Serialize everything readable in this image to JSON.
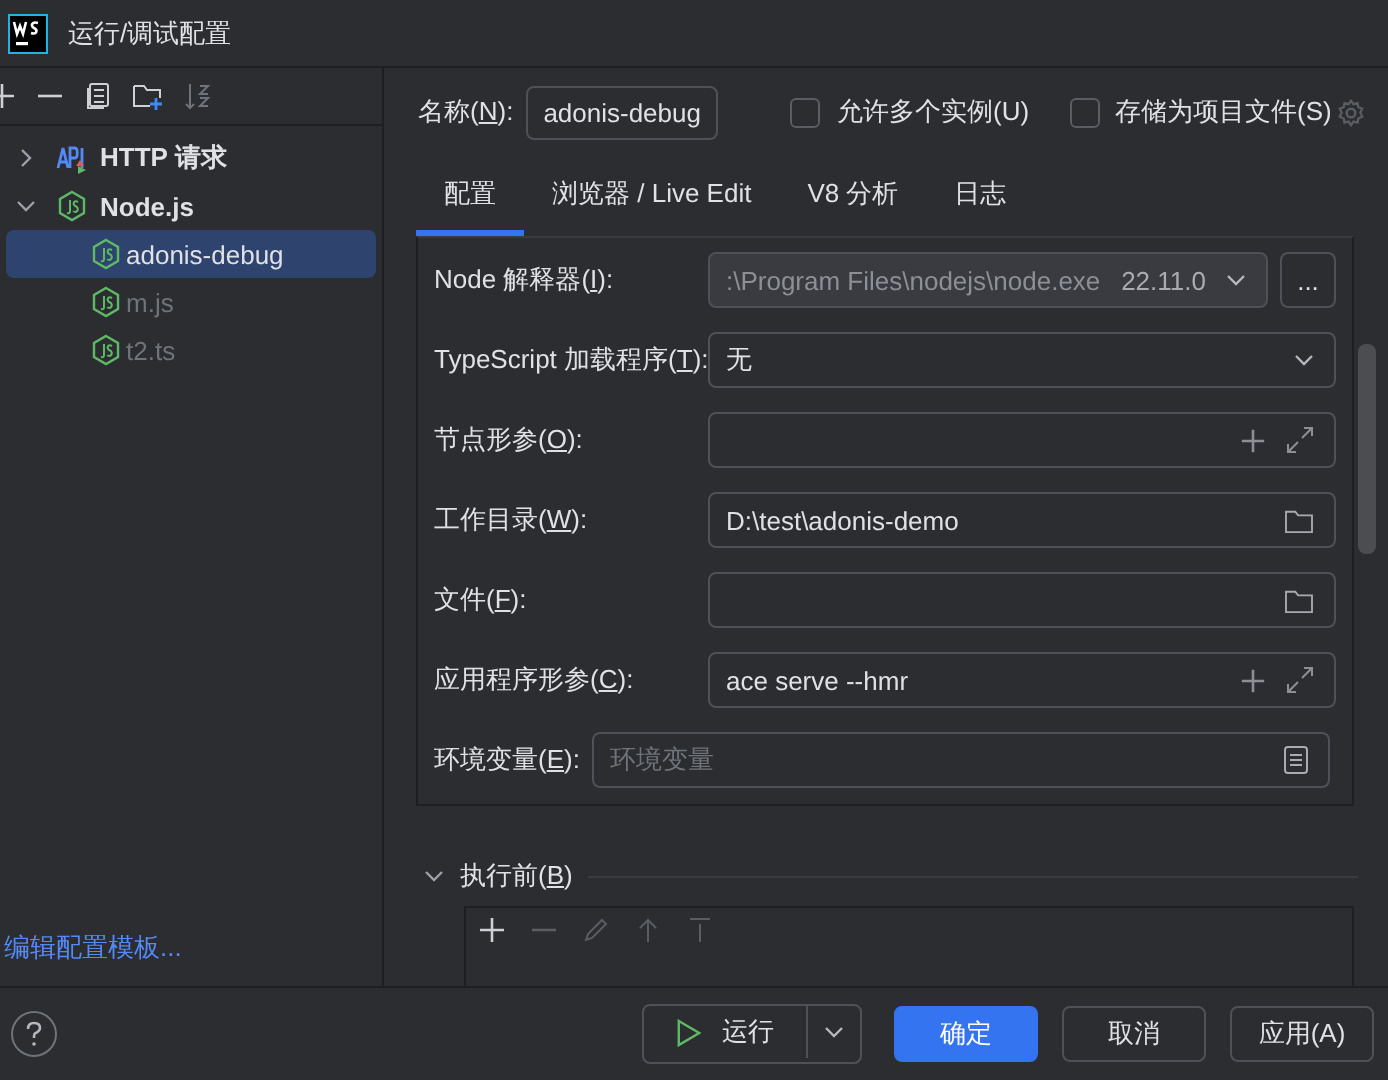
{
  "window": {
    "title": "运行/调试配置"
  },
  "tree": [
    {
      "label": "HTTP 请求",
      "kind": "http",
      "expanded": false,
      "selected": false
    },
    {
      "label": "Node.js",
      "kind": "node",
      "expanded": true,
      "selected": false,
      "children": [
        {
          "label": "adonis-debug",
          "kind": "node",
          "selected": true,
          "dimmed": false
        },
        {
          "label": "m.js",
          "kind": "node",
          "selected": false,
          "dimmed": true
        },
        {
          "label": "t2.ts",
          "kind": "node",
          "selected": false,
          "dimmed": true
        }
      ]
    }
  ],
  "template_link": "编辑配置模板...",
  "name_field": {
    "label": {
      "pre": "名称(",
      "key": "N",
      "post": "):"
    },
    "value": "adonis-debug"
  },
  "options": [
    {
      "label": "允许多个实例(U)",
      "checked": false
    },
    {
      "label": "存储为项目文件(S)",
      "checked": false
    }
  ],
  "tabs": [
    {
      "label": "配置",
      "selected": true
    },
    {
      "label": "浏览器 / Live Edit",
      "selected": false
    },
    {
      "label": "V8 分析",
      "selected": false
    },
    {
      "label": "日志",
      "selected": false
    }
  ],
  "fields": [
    {
      "kind": "interpreter",
      "label": {
        "pre": "Node 解释器(",
        "key": "I",
        "post": "):"
      },
      "value": ":\\Program Files\\nodejs\\node.exe",
      "version": "22.11.0",
      "button": "..."
    },
    {
      "kind": "select",
      "label": {
        "pre": "TypeScript 加载程序(",
        "key": "T",
        "post": "):"
      },
      "value": "无"
    },
    {
      "kind": "expandable",
      "label": {
        "pre": "节点形参(",
        "key": "O",
        "post": "):"
      }
    },
    {
      "kind": "folder",
      "label": {
        "pre": "工作目录(",
        "key": "W",
        "post": "):"
      },
      "value": "D:\\test\\adonis-demo"
    },
    {
      "kind": "folder",
      "label": {
        "pre": "文件(",
        "key": "F",
        "post": "):"
      }
    },
    {
      "kind": "expandable",
      "label": {
        "pre": "应用程序形参(",
        "key": "C",
        "post": "):"
      },
      "value": "ace serve --hmr"
    },
    {
      "kind": "env",
      "label": {
        "pre": "环境变量(",
        "key": "E",
        "post": "):"
      },
      "placeholder": "环境变量"
    }
  ],
  "before_launch": {
    "label": {
      "pre": "执行前(",
      "key": "B",
      "post": ")"
    },
    "expanded": true
  },
  "buttons": [
    {
      "label": "运行",
      "kind": "run"
    },
    {
      "label": "确定",
      "kind": "primary"
    },
    {
      "label": "取消",
      "kind": "default"
    },
    {
      "label": "应用(A)",
      "kind": "default"
    }
  ]
}
